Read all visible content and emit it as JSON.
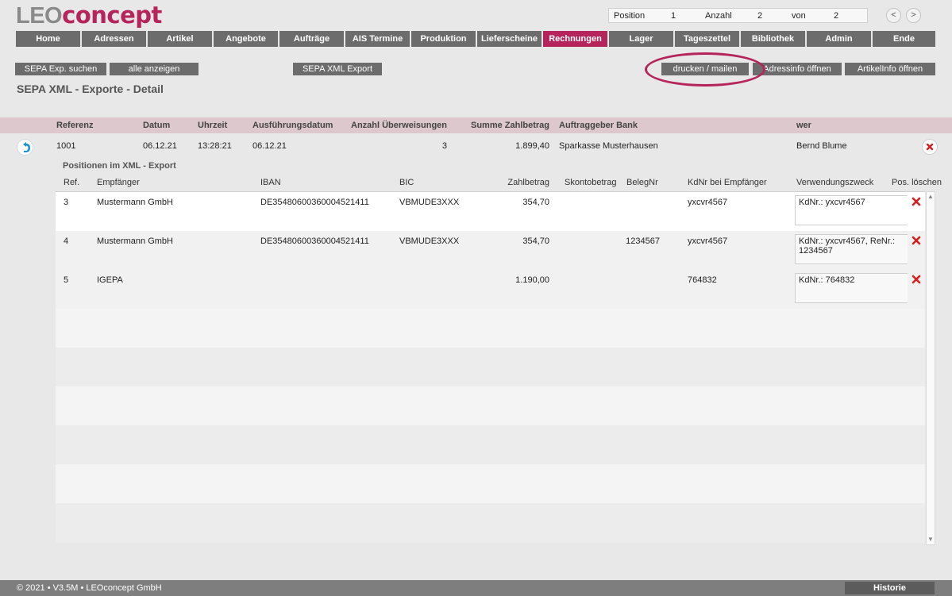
{
  "brand": {
    "part1": "LEO",
    "part2": "concept",
    "primary_color": "#8a8a8a",
    "accent_color": "#b5245a"
  },
  "position_bar": {
    "position_label": "Position",
    "position_value": "1",
    "count_label": "Anzahl",
    "count_value": "2",
    "of_label": "von",
    "of_value": "2",
    "prev_label": "<",
    "next_label": ">"
  },
  "menu": {
    "items": [
      {
        "label": "Home"
      },
      {
        "label": "Adressen"
      },
      {
        "label": "Artikel"
      },
      {
        "label": "Angebote"
      },
      {
        "label": "Aufträge"
      },
      {
        "label": "AIS Termine"
      },
      {
        "label": "Produktion"
      },
      {
        "label": "Lieferscheine"
      },
      {
        "label": "Rechnungen"
      },
      {
        "label": "Lager"
      },
      {
        "label": "Tageszettel"
      },
      {
        "label": "Bibliothek"
      },
      {
        "label": "Admin"
      },
      {
        "label": "Ende"
      }
    ],
    "active": "Rechnungen"
  },
  "toolbar": {
    "search_label": "SEPA Exp. suchen",
    "show_all_label": "alle anzeigen",
    "xml_export_label": "SEPA XML Export",
    "print_mail_label": "drucken / mailen",
    "address_info_label": "Adressinfo öffnen",
    "article_info_label": "ArtikelInfo öffnen"
  },
  "page_title": "SEPA XML - Exporte - Detail",
  "header": {
    "columns": {
      "ref": "Referenz",
      "date": "Datum",
      "time": "Uhrzeit",
      "exec_date": "Ausführungsdatum",
      "count": "Anzahl Überweisungen",
      "sum": "Summe Zahlbetrag",
      "bank": "Auftraggeber Bank",
      "who": "wer"
    },
    "record": {
      "ref": "1001",
      "date": "06.12.21",
      "time": "13:28:21",
      "exec_date": "06.12.21",
      "count": "3",
      "sum": "1.899,40",
      "bank": "Sparkasse Musterhausen",
      "who": "Bernd Blume"
    }
  },
  "positions": {
    "section_label": "Positionen im XML - Export",
    "columns": {
      "ref": "Ref.",
      "recipient": "Empfänger",
      "iban": "IBAN",
      "bic": "BIC",
      "amount": "Zahlbetrag",
      "discount": "Skontobetrag",
      "doc_no": "BelegNr",
      "cust_no": "KdNr bei Empfänger",
      "purpose": "Verwendungszweck",
      "delete": "Pos. löschen"
    },
    "rows": [
      {
        "ref": "3",
        "recipient": "Mustermann GmbH",
        "iban": "DE35480600360004521411",
        "bic": "VBMUDE3XXX",
        "amount": "354,70",
        "discount": "",
        "doc_no": "",
        "cust_no": "yxcvr4567",
        "purpose": "KdNr.: yxcvr4567"
      },
      {
        "ref": "4",
        "recipient": "Mustermann GmbH",
        "iban": "DE35480600360004521411",
        "bic": "VBMUDE3XXX",
        "amount": "354,70",
        "discount": "",
        "doc_no": "1234567",
        "cust_no": "yxcvr4567",
        "purpose": "KdNr.: yxcvr4567, ReNr.: 1234567"
      },
      {
        "ref": "5",
        "recipient": "IGEPA",
        "iban": "",
        "bic": "",
        "amount": "1.190,00",
        "discount": "",
        "doc_no": "",
        "cust_no": "764832",
        "purpose": "KdNr.: 764832"
      }
    ]
  },
  "footer": {
    "copyright": "© 2021 • V3.5M • LEOconcept GmbH",
    "history_label": "Historie"
  },
  "icons": {
    "back": "back-arrow-icon",
    "delete": "delete-x-icon"
  }
}
